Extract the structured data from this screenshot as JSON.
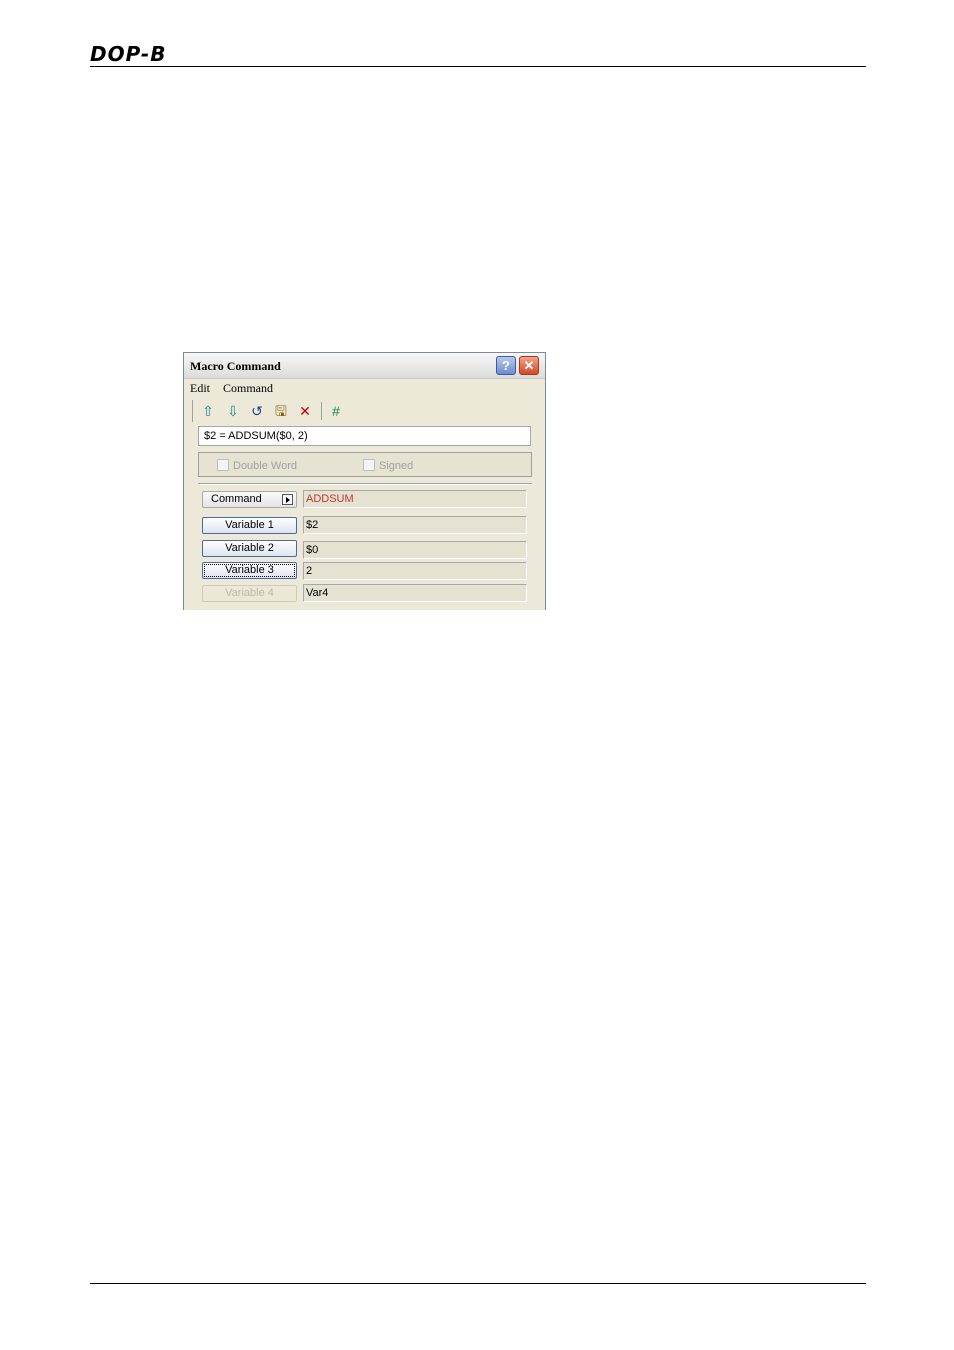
{
  "header": {
    "logo_text": "DOP-B"
  },
  "dialog": {
    "title": "Macro Command",
    "help_label": "?",
    "close_label": "✕",
    "menu": [
      "Edit",
      "Command"
    ],
    "toolbar": [
      {
        "name": "move-up-icon",
        "glyph": "⇧",
        "color": "#1a8a8a"
      },
      {
        "name": "move-down-icon",
        "glyph": "⇩",
        "color": "#1a8a8a"
      },
      {
        "name": "undo-icon",
        "glyph": "↺",
        "color": "#1d3f8a"
      },
      {
        "name": "save-icon",
        "glyph": "🖫",
        "color": "#8a5a00"
      },
      {
        "name": "delete-icon",
        "glyph": "✕",
        "color": "#cc0000"
      },
      {
        "name": "hash-icon",
        "glyph": "#",
        "color": "#1a8a5a"
      }
    ],
    "expression": "$2 = ADDSUM($0, 2)",
    "options": {
      "double_word": "Double Word",
      "signed": "Signed"
    },
    "rows": {
      "command": {
        "label": "Command",
        "value": "ADDSUM"
      },
      "var1": {
        "label": "Variable 1",
        "value": "$2"
      },
      "var2": {
        "label": "Variable 2",
        "value": "$0"
      },
      "var3": {
        "label": "Variable 3",
        "value": "2"
      },
      "var4": {
        "label": "Variable 4",
        "value": "Var4"
      }
    }
  }
}
